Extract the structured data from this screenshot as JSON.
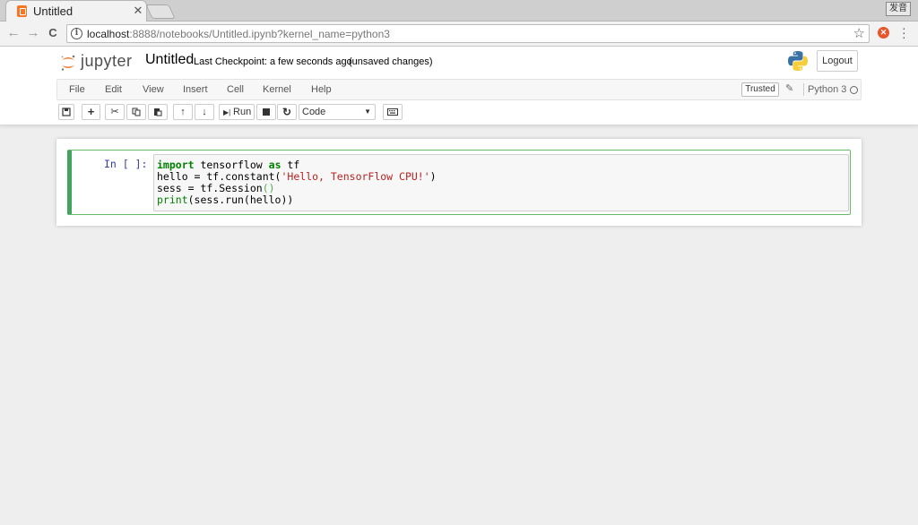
{
  "browser": {
    "tab_title": "Untitled",
    "tab_close": "✕",
    "ime_label": "发音",
    "url_host": "localhost",
    "url_path": ":8888/notebooks/Untitled.ipynb?kernel_name=python3",
    "back_icon": "←",
    "forward_icon": "→",
    "reload_icon": "C",
    "star_icon": "☆",
    "ext_icon": "✕"
  },
  "header": {
    "logo_text": "jupyter",
    "notebook_name": "Untitled",
    "checkpoint": "Last Checkpoint: a few seconds ago",
    "unsaved": "(unsaved changes)",
    "logout_label": "Logout"
  },
  "menubar": {
    "items": [
      "File",
      "Edit",
      "View",
      "Insert",
      "Cell",
      "Kernel",
      "Help"
    ],
    "trusted_label": "Trusted",
    "kernel_name": "Python 3"
  },
  "toolbar": {
    "run_label": "Run",
    "cell_type": "Code",
    "icons": [
      "save-icon",
      "plus-icon",
      "cut-icon",
      "copy-icon",
      "paste-icon",
      "arrow-up-icon",
      "arrow-down-icon",
      "step-forward-icon",
      "stop-icon",
      "restart-icon",
      "keyboard-icon"
    ]
  },
  "cell": {
    "prompt": "In [ ]:",
    "lines": {
      "l1_kw": "import",
      "l1_rest": " tensorflow ",
      "l1_kw2": "as",
      "l1_end": " tf",
      "l2_start": "hello = tf.constant(",
      "l2_str": "'Hello, TensorFlow CPU!'",
      "l2_end": ")",
      "l3_start": "sess = tf.Session",
      "l3_paren": "()",
      "l4_bi": "print",
      "l4_end": "(sess.run(hello))"
    }
  },
  "colors": {
    "jupyter_orange": "#f37726",
    "cell_border": "#42a45c",
    "prompt_blue": "#303f9f"
  }
}
